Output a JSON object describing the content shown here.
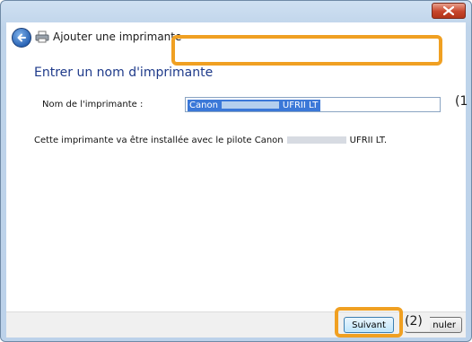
{
  "window": {
    "title": "Ajouter une imprimante"
  },
  "content": {
    "heading": "Entrer un nom d'imprimante",
    "field_label": "Nom de l'imprimante :",
    "printer_name_prefix": "Canon",
    "printer_name_suffix": "UFRII LT",
    "info_prefix": "Cette imprimante va être installée avec le pilote Canon",
    "info_suffix": "UFRII LT."
  },
  "footer": {
    "next_label": "Suivant",
    "cancel_label": "nuler"
  },
  "annotations": {
    "callout1": "(1",
    "callout2": "(2)",
    "highlight_color": "#f0a022"
  }
}
